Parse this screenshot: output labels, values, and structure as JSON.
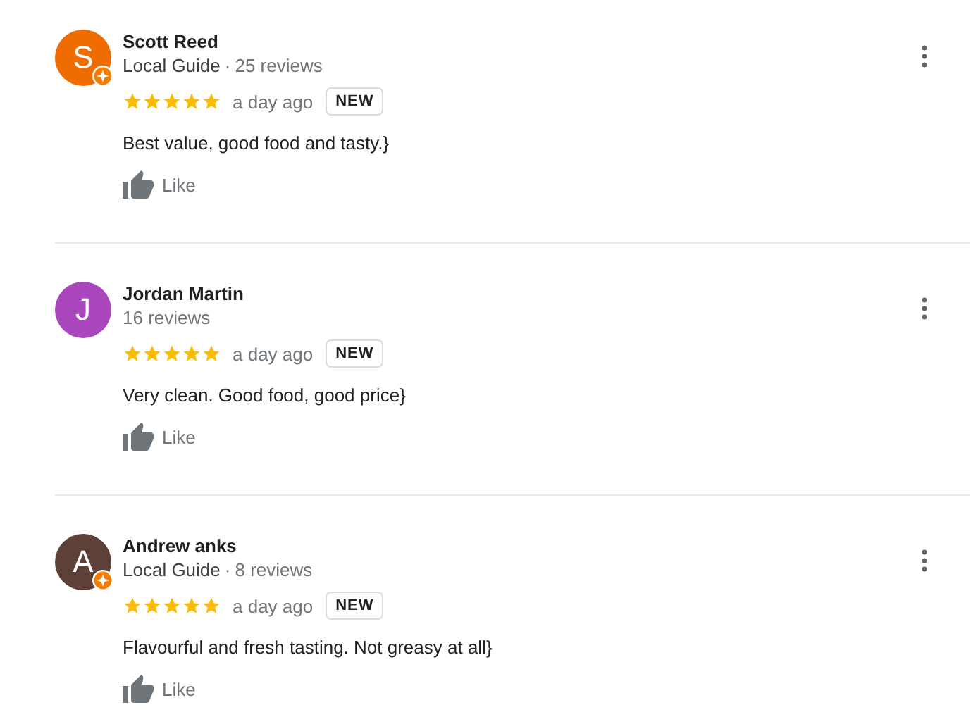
{
  "reviews": [
    {
      "name": "Scott Reed",
      "initial": "S",
      "color": "#ef6c00",
      "local_guide": true,
      "guide_label": "Local Guide",
      "separator": "·",
      "review_count": "25 reviews",
      "stars": 5,
      "time": "a day ago",
      "badge": "NEW",
      "text": "Best value, good food and tasty.}",
      "like_label": "Like"
    },
    {
      "name": "Jordan Martin",
      "initial": "J",
      "color": "#ab47bc",
      "local_guide": false,
      "review_count": "16 reviews",
      "stars": 5,
      "time": "a day ago",
      "badge": "NEW",
      "text": "Very clean. Good food, good price}",
      "like_label": "Like"
    },
    {
      "name": "Andrew anks",
      "initial": "A",
      "color": "#5d4037",
      "local_guide": true,
      "guide_label": "Local Guide",
      "separator": "·",
      "review_count": "8 reviews",
      "stars": 5,
      "time": "a day ago",
      "badge": "NEW",
      "text": "Flavourful and fresh tasting. Not greasy at all}",
      "like_label": "Like"
    }
  ]
}
